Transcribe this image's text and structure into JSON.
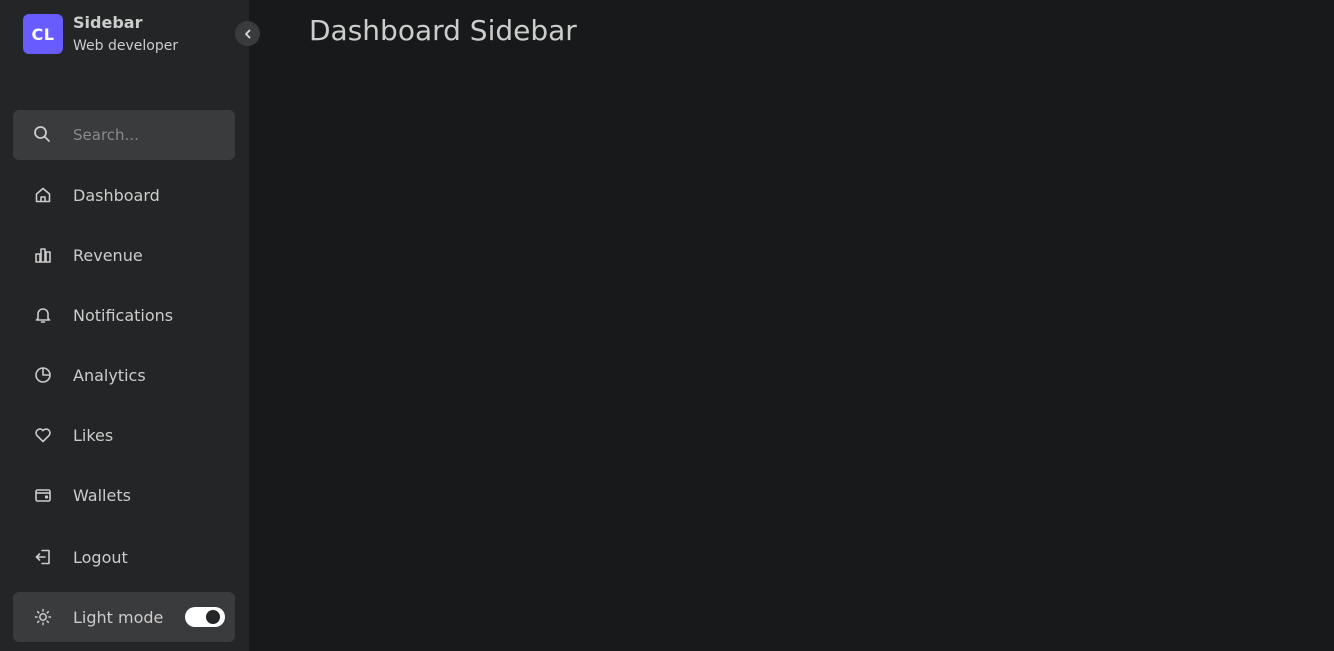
{
  "brand": {
    "logo_text": "CL",
    "name": "Sidebar",
    "role": "Web developer"
  },
  "search": {
    "placeholder": "Search..."
  },
  "nav": {
    "items": [
      {
        "label": "Dashboard",
        "icon": "home-icon"
      },
      {
        "label": "Revenue",
        "icon": "bar-chart-icon"
      },
      {
        "label": "Notifications",
        "icon": "bell-icon"
      },
      {
        "label": "Analytics",
        "icon": "pie-chart-icon"
      },
      {
        "label": "Likes",
        "icon": "heart-icon"
      },
      {
        "label": "Wallets",
        "icon": "wallet-icon"
      }
    ],
    "logout": {
      "label": "Logout",
      "icon": "logout-icon"
    }
  },
  "mode": {
    "label": "Light mode",
    "icon": "sun-icon",
    "switch_on": true
  },
  "main": {
    "title": "Dashboard Sidebar"
  },
  "colors": {
    "accent": "#695cfe",
    "sidebar_bg": "#242526",
    "page_bg": "#18191a",
    "text": "#cccccc"
  }
}
